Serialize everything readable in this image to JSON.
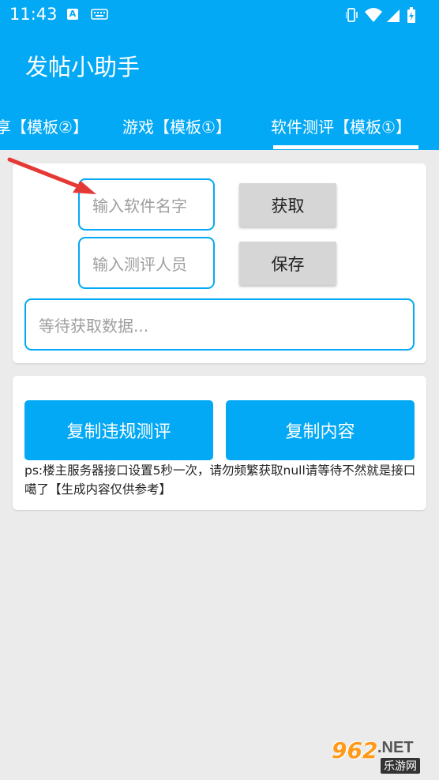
{
  "status_bar": {
    "time": "11:43",
    "left_icons": [
      "font-icon",
      "keyboard-icon"
    ],
    "right_icons": [
      "vibrate-icon",
      "wifi-icon",
      "signal-icon",
      "battery-icon"
    ]
  },
  "app_bar": {
    "title": "发帖小助手"
  },
  "tabs": {
    "items": [
      {
        "label": "享【模板②】"
      },
      {
        "label": "游戏【模板①】"
      },
      {
        "label": "软件测评【模板①】",
        "active": true
      }
    ]
  },
  "form": {
    "software_name_placeholder": "输入软件名字",
    "fetch_label": "获取",
    "reviewer_placeholder": "输入测评人员",
    "save_label": "保存",
    "result_placeholder": "等待获取数据..."
  },
  "actions": {
    "copy_violation_label": "复制违规测评",
    "copy_content_label": "复制内容",
    "note": "ps:楼主服务器接口设置5秒一次，请勿频繁获取null请等待不然就是接口噶了【生成内容仅供参考】"
  },
  "watermark": {
    "brand": "962",
    "domain": ".NET",
    "sub": "乐游网"
  },
  "colors": {
    "primary": "#03a9f4",
    "background": "#ebebeb",
    "arrow": "#e53935"
  }
}
